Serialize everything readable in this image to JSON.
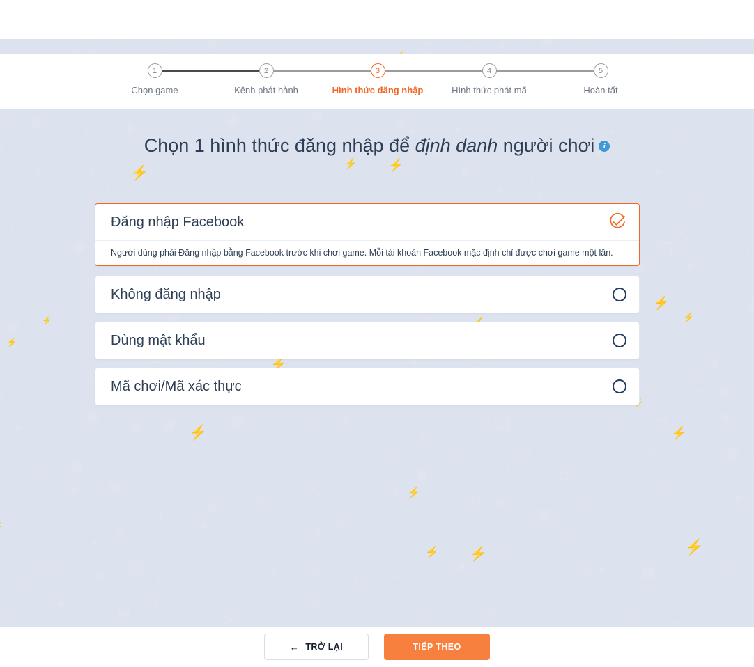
{
  "stepper": {
    "steps": [
      {
        "number": "1",
        "label": "Chọn game",
        "state": "done"
      },
      {
        "number": "2",
        "label": "Kênh phát hành",
        "state": "done"
      },
      {
        "number": "3",
        "label": "Hình thức đăng nhập",
        "state": "active"
      },
      {
        "number": "4",
        "label": "Hình thức phát mã",
        "state": "upcoming"
      },
      {
        "number": "5",
        "label": "Hoàn tất",
        "state": "upcoming"
      }
    ],
    "active_color": "#f26722",
    "inactive_color": "#6d7684"
  },
  "main": {
    "heading_part1": "Chọn 1 hình thức đăng nhập để ",
    "heading_emphasis": "định danh",
    "heading_part2": " người chơi",
    "info_icon": "info-icon",
    "info_icon_glyph": "i",
    "options": [
      {
        "title": "Đăng nhập Facebook",
        "selected": true,
        "icon": "check-circle-icon",
        "description": "Người dùng phải Đăng nhập bằng Facebook trước khi chơi game. Mỗi tài khoản Facebook mặc định chỉ được chơi game một lần."
      },
      {
        "title": "Không đăng nhập",
        "selected": false,
        "icon": "radio-empty-icon",
        "description": ""
      },
      {
        "title": "Dùng mật khẩu",
        "selected": false,
        "icon": "radio-empty-icon",
        "description": ""
      },
      {
        "title": "Mã chơi/Mã xác thực",
        "selected": false,
        "icon": "radio-empty-icon",
        "description": ""
      }
    ]
  },
  "footer": {
    "back_label": "TRỞ LẠI",
    "back_icon": "arrow-left-icon",
    "back_arrow_glyph": "←",
    "next_label": "TIẾP THEO",
    "next_color": "#f7803f"
  }
}
